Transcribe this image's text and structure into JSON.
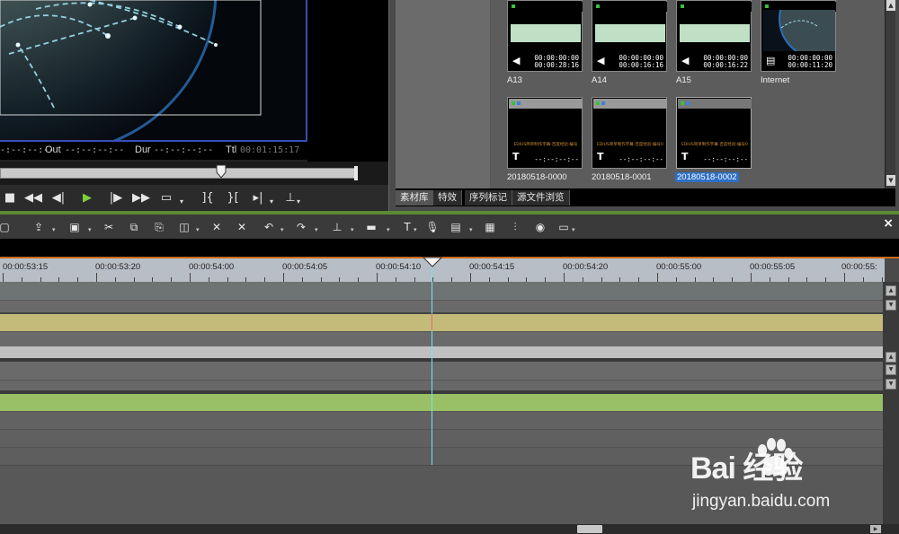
{
  "player": {
    "in_label": "-:--:--:--",
    "out_label": "Out",
    "out_value": "--:--:--:--",
    "dur_label": "Dur",
    "dur_value": "--:--:--:--",
    "ttl_label": "Ttl",
    "ttl_value": "00:01:15:17",
    "transport": {
      "stop": "stop-icon",
      "rewind": "rewind-icon",
      "step_back": "step-back-icon",
      "play": "play-icon",
      "step_forward": "step-forward-icon",
      "fast_forward": "fast-forward-icon",
      "output": "output-icon",
      "set_in": "set-in-icon",
      "set_out": "set-out-icon",
      "insert": "insert-icon",
      "overwrite": "overwrite-icon"
    }
  },
  "bin": {
    "clips": [
      {
        "name": "A13",
        "kind": "audio",
        "tc1": "00:00:00:00",
        "tc2": "00:00:28:16"
      },
      {
        "name": "A14",
        "kind": "audio",
        "tc1": "00:00:00:00",
        "tc2": "00:00:16:16"
      },
      {
        "name": "A15",
        "kind": "audio",
        "tc1": "00:00:00:00",
        "tc2": "00:00:16:22"
      },
      {
        "name": "Internet",
        "kind": "video",
        "tc1": "00:00:00:00",
        "tc2": "00:00:11:20"
      },
      {
        "name": "20180518-0000",
        "kind": "title",
        "tc": "--:--:--:--",
        "caption": "EDIUS简单制作字幕-百度经验-编号"
      },
      {
        "name": "20180518-0001",
        "kind": "title",
        "tc": "--:--:--:--",
        "caption": "EDIUS简单制作字幕-百度经验-编号001"
      },
      {
        "name": "20180518-0002",
        "kind": "title",
        "tc": "--:--:--:--",
        "caption": "EDIUS简单制作字幕-百度经验-编号002",
        "selected": true
      }
    ],
    "tabs": [
      "素材库",
      "特效",
      "序列标记",
      "源文件浏览"
    ],
    "active_tab": 0
  },
  "timeline": {
    "ruler_labels": [
      "00:00:53:15",
      "00:00:53:20",
      "00:00:54:00",
      "00:00:54:05",
      "00:00:54:10",
      "00:00:54:15",
      "00:00:54:20",
      "00:00:55:00",
      "00:00:55:05",
      "00:00:55:"
    ],
    "close": "×",
    "colors": {
      "accent": "#5a8a32",
      "audio_track": "#c4bb7a",
      "video_track": "#99c066",
      "playhead": "#7fe0e8"
    }
  },
  "watermark": {
    "logo": "Bai 经验",
    "url": "jingyan.baidu.com"
  }
}
